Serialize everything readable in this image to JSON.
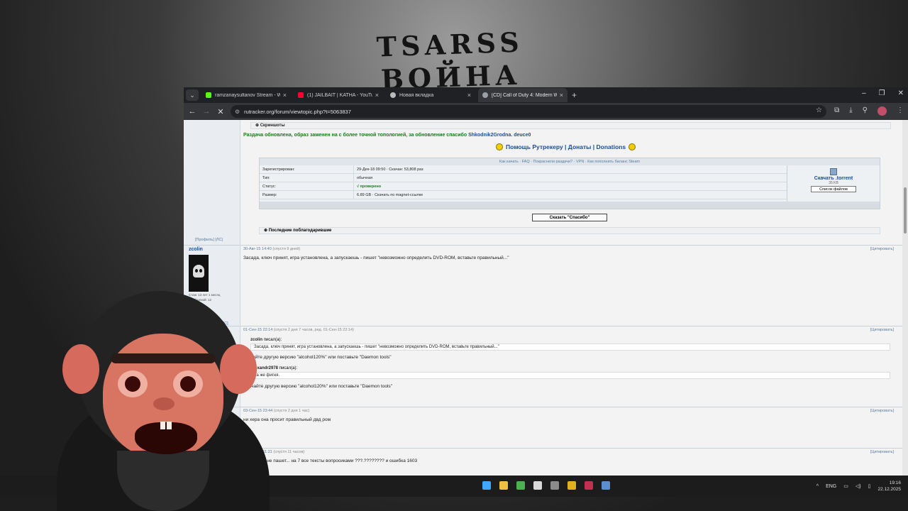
{
  "background": {
    "stream_title_lines": [
      "TSARSS",
      "ВОЙНА"
    ]
  },
  "browser": {
    "tabs": [
      {
        "label": "ramzanaysultanov Stream - We",
        "color": "#53fc18",
        "active": false
      },
      {
        "label": "(1) JAILBAIT | KATHA - YouTube",
        "color": "#ff0033",
        "active": false
      },
      {
        "label": "Новая вкладка",
        "color": "#bbbbbb",
        "active": false
      },
      {
        "label": "[CD] Call of Duty 4: Modern W",
        "color": "#9aa0a6",
        "active": true
      }
    ],
    "url": "rutracker.org/forum/viewtopic.php?t=5063837"
  },
  "topic": {
    "spoiler_label": "Скриншоты",
    "update_text": "Раздача обновлена, образ заменен на с более точной топологией, за обновление спасибо",
    "update_thanks": "Shkodnik2Grodna. deuce0",
    "help_bar": "Помощь Рутрекеру | Донаты | Donations",
    "info_links": "Как качать · FAQ · Покраснели раздачи? · VPN · Как пополнить баланс Steam",
    "info": [
      {
        "key": "Зарегистрирован:",
        "value": "29-Дек-18 09:50 · Скачан: 53,808 раз"
      },
      {
        "key": "Тип:",
        "value": "обычная"
      },
      {
        "key": "Статус:",
        "value": "√ проверено"
      },
      {
        "key": "Размер:",
        "value": "6.89 GB · Скачать по magnet-ссылке"
      }
    ],
    "download_label": "Скачать .torrent",
    "download_size": "35 KB",
    "file_list_label": "Список файлов",
    "thanks_button": "Сказать \"Спасибо\"",
    "last_thanks_label": "Последние поблагодарившие",
    "profile_links": "[Профиль] [ЛС]"
  },
  "posts": [
    {
      "author": "zcolin",
      "date": "30-Авг-15 14:40",
      "meta": "(спустя 9 дней)",
      "quote": "[Цитировать]",
      "text": "Засада, ключ принят, игра установлена, а запускаешь - пишет \"невозможно определить DVD-ROM, вставьте правильный...\"",
      "author_info": [
        "Стаж: 13 лет 1 месяц",
        "Сообщений: 12"
      ]
    },
    {
      "date": "01-Сен-15 22:14",
      "meta": "(спустя 2 дня 7 часов, ред. 01-Сен-15 22:14)",
      "quote": "[Цитировать]",
      "quotes": [
        {
          "author": "zcolin",
          "wrote": "писал(а):",
          "text": "Засада, ключ принят, игра установлена, а запускаешь - пишет \"невозможно определить DVD-ROM, вставьте правильный...\""
        },
        {
          "author": "Alexandr2978",
          "wrote": "писал(а):",
          "text": "Та же фигня."
        }
      ],
      "line1": "скачайте другую версию \"alcohol120%\" или поставьте \"Daemon tools\"",
      "line2": "Скачайте другую версию \"alcohol120%\" или поставьте \"Daemon tools\"",
      "profile": "[ЛС]"
    },
    {
      "date": "03-Сен-15 23:44",
      "meta": "(спустя 2 дня 1 час)",
      "quote": "[Цитировать]",
      "text": "ни хера она просит правильный двд ром"
    },
    {
      "date": "04-Сен-15 11:21",
      "meta": "(спустя 11 часов)",
      "quote": "[Цитировать]",
      "text": "меня тоже не пашет... на 7 все тексты вопросиками ???.???????? и ошибка 1603"
    }
  ],
  "taskbar": {
    "lang": "ENG",
    "time": "19:16",
    "date": "22.12.2025",
    "icons": [
      {
        "name": "windows",
        "color": "#3fa7ff"
      },
      {
        "name": "explorer",
        "color": "#f0c040"
      },
      {
        "name": "chrome",
        "color": "#4caf50"
      },
      {
        "name": "app",
        "color": "#d9d9d9"
      },
      {
        "name": "obs",
        "color": "#8b8b8b"
      },
      {
        "name": "app2",
        "color": "#e0b020"
      },
      {
        "name": "app3",
        "color": "#c03050"
      },
      {
        "name": "steam",
        "color": "#5a8fd0"
      }
    ]
  }
}
